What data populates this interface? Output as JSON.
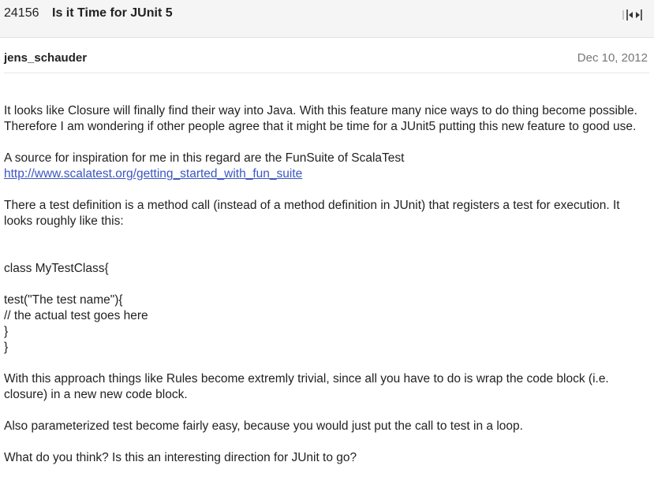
{
  "header": {
    "thread_id": "24156",
    "title": "Is it Time for JUnit 5",
    "expand_icon": "expand-horizontal-icon"
  },
  "post": {
    "author": "jens_schauder",
    "date": "Dec 10, 2012",
    "paragraphs": {
      "p1": "It looks like Closure will finally find their way into Java. With this feature many nice ways to do thing become possible. Therefore I am wondering if other people agree that it might be time for a JUnit5 putting this new feature to good use.",
      "p2": "A source for inspiration for me in this regard are the FunSuite of ScalaTest",
      "link": "http://www.scalatest.org/getting_started_with_fun_suite",
      "p3": "There a test definition is a method call (instead of a method definition in JUnit) that registers a test for execution. It looks roughly like this:",
      "code_line1": "class MyTestClass{",
      "code_line2": "test(\"The test name\"){",
      "code_line3": "// the actual test goes here",
      "code_line4": "}",
      "code_line5": "}",
      "p4": "With this approach things like Rules become extremly trivial, since all you have to do is wrap the code block (i.e. closure) in a new new code block.",
      "p5": "Also parameterized test become fairly easy, because you would just put the call to test in a loop.",
      "p6": "What do you think? Is this an interesting direction for JUnit to go?"
    }
  }
}
